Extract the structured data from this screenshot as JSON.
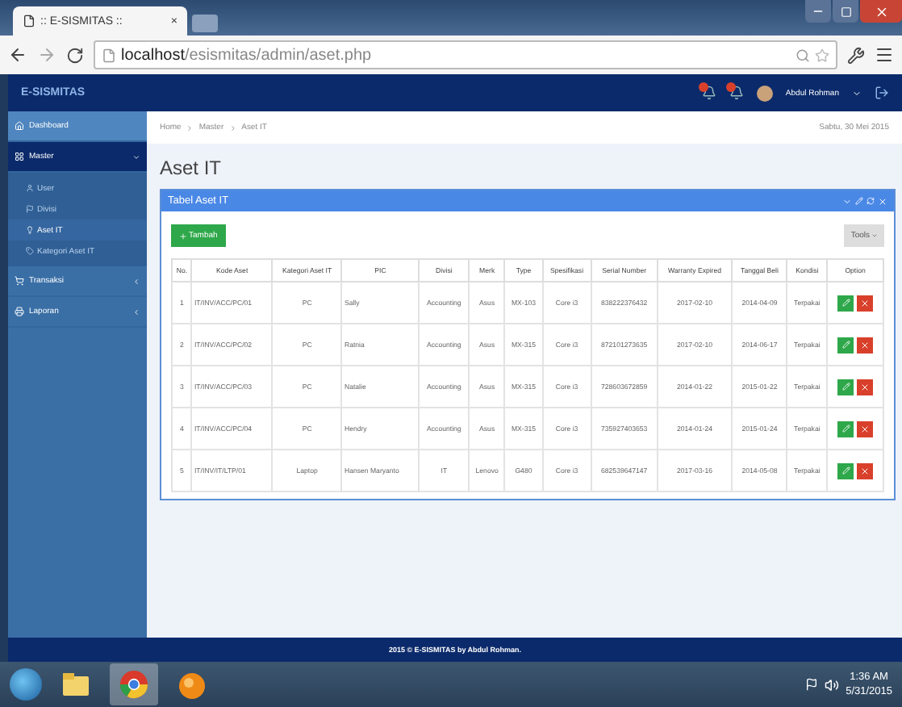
{
  "browser": {
    "tab_title": ":: E-SISMITAS ::",
    "tab_close": "×",
    "url_host": "localhost",
    "url_path": "/esismitas/admin/aset.php"
  },
  "header": {
    "brand": "E-SISMITAS",
    "user": "Abdul Rohman"
  },
  "sidebar": {
    "items": [
      {
        "label": "Dashboard",
        "selected": false
      },
      {
        "label": "Master",
        "selected": true,
        "expanded": true,
        "children": [
          {
            "label": "User",
            "selected": false
          },
          {
            "label": "Divisi",
            "selected": false
          },
          {
            "label": "Aset IT",
            "selected": true
          },
          {
            "label": "Kategori Aset IT",
            "selected": false
          }
        ]
      },
      {
        "label": "Transaksi",
        "selected": false,
        "expanded": false
      },
      {
        "label": "Laporan",
        "selected": false,
        "expanded": false
      }
    ]
  },
  "breadcrumb": [
    "Home",
    "Master",
    "Aset IT"
  ],
  "date": "Sabtu, 30 Mei 2015",
  "page_title": "Aset IT",
  "panel": {
    "title": "Tabel Aset IT",
    "add_button": "Tambah",
    "tools_button": "Tools",
    "columns": [
      "No.",
      "Kode Aset",
      "Kategori Aset IT",
      "PIC",
      "Divisi",
      "Merk",
      "Type",
      "Spesifikasi",
      "Serial Number",
      "Warranty Expired",
      "Tanggal Beli",
      "Kondisi",
      "Option"
    ],
    "rows": [
      [
        "1",
        "IT/INV/ACC/PC/01",
        "PC",
        "Sally",
        "Accounting",
        "Asus",
        "MX-103",
        "Core i3",
        "838222376432",
        "2017-02-10",
        "2014-04-09",
        "Terpakai"
      ],
      [
        "2",
        "IT/INV/ACC/PC/02",
        "PC",
        "Ratnia",
        "Accounting",
        "Asus",
        "MX-315",
        "Core i3",
        "872101273635",
        "2017-02-10",
        "2014-06-17",
        "Terpakai"
      ],
      [
        "3",
        "IT/INV/ACC/PC/03",
        "PC",
        "Natalie",
        "Accounting",
        "Asus",
        "MX-315",
        "Core i3",
        "728603672859",
        "2014-01-22",
        "2015-01-22",
        "Terpakai"
      ],
      [
        "4",
        "IT/INV/ACC/PC/04",
        "PC",
        "Hendry",
        "Accounting",
        "Asus",
        "MX-315",
        "Core i3",
        "735927403653",
        "2014-01-24",
        "2015-01-24",
        "Terpakai"
      ],
      [
        "5",
        "IT/INV/IT/LTP/01",
        "Laptop",
        "Hansen Maryanto",
        "IT",
        "Lenovo",
        "G480",
        "Core i3",
        "682539647147",
        "2017-03-16",
        "2014-05-08",
        "Terpakai"
      ]
    ]
  },
  "footer": "2015 © E-SISMITAS by Abdul Rohman.",
  "taskbar": {
    "apps": [
      {
        "kind": "explorer",
        "selected": false
      },
      {
        "kind": "chrome",
        "selected": true
      },
      {
        "kind": "orange",
        "selected": false
      }
    ],
    "time": "1:36 AM",
    "date": "5/31/2015"
  }
}
